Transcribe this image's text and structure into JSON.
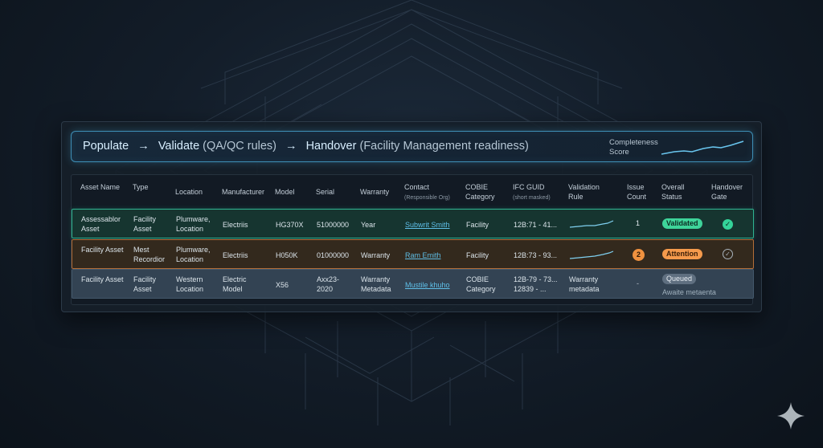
{
  "header": {
    "steps": [
      "Populate",
      "Validate",
      "Handover"
    ],
    "validate_note": "(QA/QC rules)",
    "handover_note": "(Facility Management readiness)",
    "arrow": "→",
    "completeness_label": "Completeness Score"
  },
  "table": {
    "columns": [
      {
        "label": "Asset Name",
        "sub": ""
      },
      {
        "label": "Type",
        "sub": ""
      },
      {
        "label": "Location",
        "sub": ""
      },
      {
        "label": "Manufacturer",
        "sub": ""
      },
      {
        "label": "Model",
        "sub": ""
      },
      {
        "label": "Serial",
        "sub": ""
      },
      {
        "label": "Warranty",
        "sub": ""
      },
      {
        "label": "Contact",
        "sub": "(Responsible Org)"
      },
      {
        "label": "COBIE Category",
        "sub": ""
      },
      {
        "label": "IFC GUID",
        "sub": "(short masked)"
      },
      {
        "label": "Validation Rule",
        "sub": ""
      },
      {
        "label": "Issue Count",
        "sub": ""
      },
      {
        "label": "Overall Status",
        "sub": ""
      },
      {
        "label": "Handover Gate",
        "sub": ""
      }
    ],
    "rows": [
      {
        "asset_name": "Assessablor Asset",
        "type": "Facility Asset",
        "location": "Plumware, Location",
        "manufacturer": "Electriis",
        "model": "HG370X",
        "serial": "51000000",
        "warranty": "Year",
        "contact": "Subwrit Smith",
        "cobie_category": "Facility",
        "ifc_guid": "12B:71 - 41...",
        "validation_rule": "",
        "issue_count": "1",
        "status": "Validated",
        "gate_icon": "✓",
        "status_color": "#3ed49a"
      },
      {
        "asset_name": "Facility Asset",
        "type": "Mest Recordior",
        "location": "Plumware, Location",
        "manufacturer": "Electriis",
        "model": "H050K",
        "serial": "01000000",
        "warranty": "Warranty",
        "contact": "Ram Emith",
        "cobie_category": "Facility",
        "ifc_guid": "12B:73 - 93...",
        "validation_rule": "",
        "issue_count": "2",
        "status": "Attention",
        "gate_icon": "✓",
        "status_color": "#f59a4c"
      },
      {
        "asset_name": "Facility Asset",
        "type": "Facility Asset",
        "location": "Western Location",
        "manufacturer": "Electric Model",
        "model": "X56",
        "serial": "Axx23- 2020",
        "warranty": "Warranty Metadata",
        "contact": "Mustile khuho",
        "cobie_category": "COBIE Category",
        "ifc_guid": "12B-79 - 73... 12839 - ...",
        "validation_rule": "Warranty metadata",
        "issue_count": "-",
        "status": "Queued",
        "status_note": "Awaite metaenta",
        "status_color": "#5f6f80"
      }
    ]
  },
  "colors": {
    "accent": "#3e8fb6",
    "validated": "#3ed49a",
    "attention": "#f59a4c",
    "queued": "#5f6f80"
  }
}
